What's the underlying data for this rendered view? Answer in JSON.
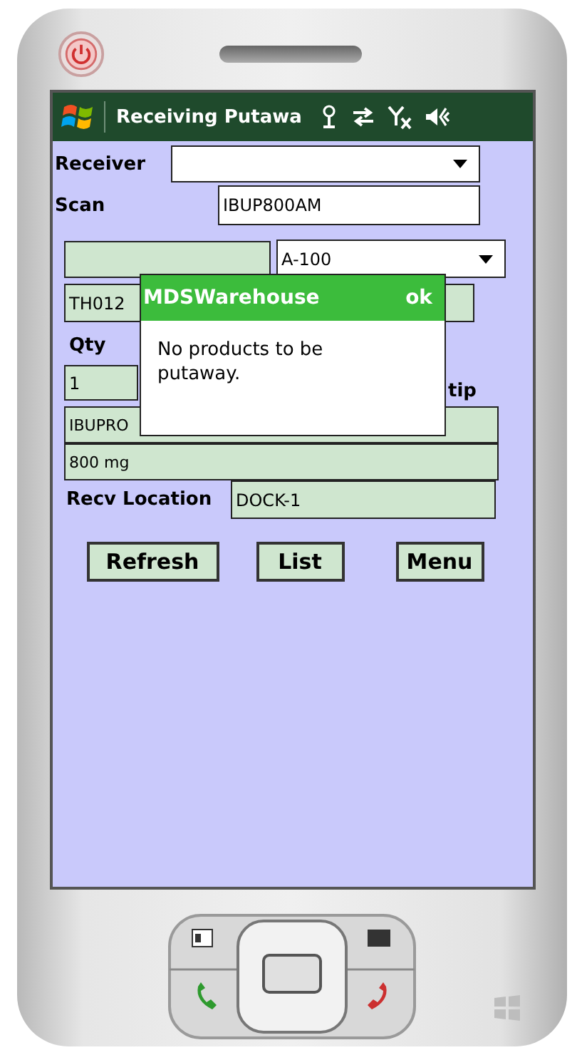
{
  "title_bar": {
    "title": "Receiving Putawa"
  },
  "form": {
    "receiver": {
      "label": "Receiver"
    },
    "scan": {
      "label": "Scan",
      "value": "IBUP800AM"
    },
    "location_combo": {
      "value": "A-100"
    },
    "lot_field": {
      "value": "TH012"
    },
    "qty": {
      "label": "Qty",
      "value": "1"
    },
    "description_label": "tip",
    "description_lines": [
      "IBUPRO",
      "800 mg"
    ],
    "recv_location": {
      "label": "Recv Location",
      "value": "DOCK-1"
    }
  },
  "buttons": [
    "Refresh",
    "List",
    "Menu"
  ],
  "dialog": {
    "title": "MDSWarehouse",
    "ok": "ok",
    "message": "No products to be putaway."
  }
}
